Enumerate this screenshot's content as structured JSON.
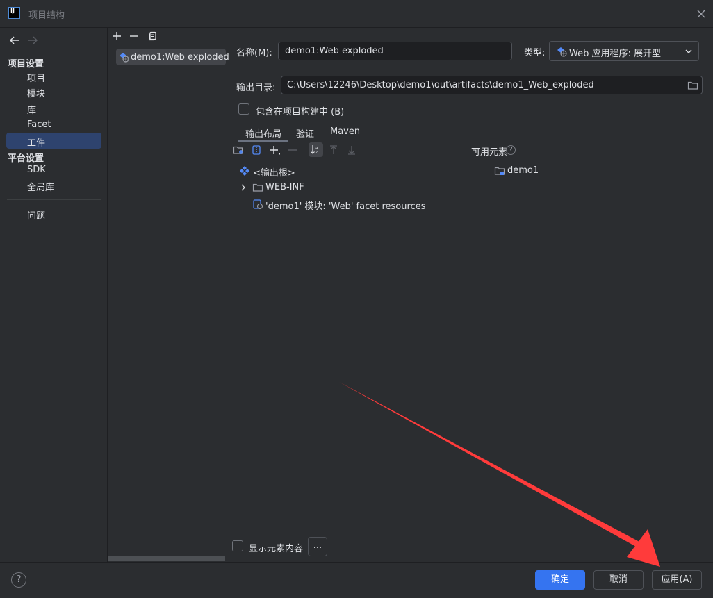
{
  "window": {
    "title": "项目结构",
    "logo_text": "IJ"
  },
  "nav": {
    "project_settings_header": "项目设置",
    "project_items": [
      "项目",
      "模块",
      "库",
      "Facet",
      "工件"
    ],
    "platform_settings_header": "平台设置",
    "platform_items": [
      "SDK",
      "全局库"
    ],
    "problems": "问题",
    "selected": "工件"
  },
  "artifact_list": {
    "items": [
      "demo1:Web exploded"
    ]
  },
  "form": {
    "name_label": "名称(M):",
    "name_value": "demo1:Web exploded",
    "type_label": "类型:",
    "type_value": "Web 应用程序: 展开型",
    "output_dir_label": "输出目录:",
    "output_dir_value": "C:\\Users\\12246\\Desktop\\demo1\\out\\artifacts\\demo1_Web_exploded",
    "include_in_build_label": "包含在项目构建中 (B)",
    "include_in_build_checked": false
  },
  "tabs": [
    "输出布局",
    "验证",
    "Maven"
  ],
  "active_tab": "输出布局",
  "layout_tree": {
    "root": "<输出根>",
    "children": [
      "WEB-INF",
      "'demo1' 模块: 'Web' facet resources"
    ]
  },
  "available": {
    "label": "可用元素",
    "items": [
      "demo1"
    ]
  },
  "show_contents": {
    "label": "显示元素内容",
    "checked": false,
    "more_button": "..."
  },
  "footer": {
    "help": "?",
    "ok": "确定",
    "cancel": "取消",
    "apply": "应用(A)"
  },
  "colors": {
    "background": "#2b2d30",
    "accent": "#3574f0",
    "selection": "#2e436e",
    "annotation_arrow": "#ff3b3b"
  }
}
